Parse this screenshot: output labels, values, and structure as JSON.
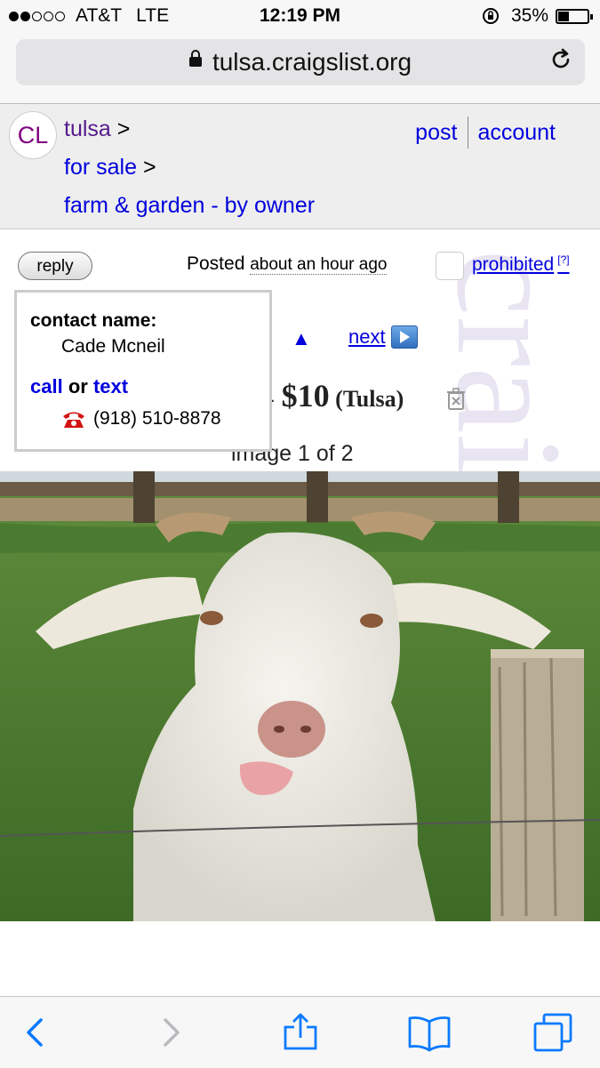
{
  "status_bar": {
    "signal_dots_filled": 2,
    "signal_dots_total": 5,
    "carrier": "AT&T",
    "network": "LTE",
    "time": "12:19 PM",
    "battery": "35%",
    "battery_level": 0.35
  },
  "browser": {
    "url": "tulsa.craigslist.org"
  },
  "header": {
    "logo": "CL",
    "crumbs": [
      {
        "label": "tulsa",
        "sep": ">"
      },
      {
        "label": "for sale",
        "sep": ">"
      },
      {
        "label": "farm & garden - by owner",
        "sep": ""
      }
    ],
    "post_label": "post",
    "account_label": "account"
  },
  "posting": {
    "reply_label": "reply",
    "posted_label": "Posted",
    "posted_ago": "about an hour ago",
    "prohibited_label": "prohibited",
    "prohibited_help": "[?]",
    "next_label": "next",
    "title_dash": "-",
    "price": "$10",
    "location": "(Tulsa)",
    "image_counter": "image 1 of 2"
  },
  "contact": {
    "name_label": "contact name:",
    "name": "Cade Mcneil",
    "call_label": "call",
    "or_label": "or",
    "text_label": "text",
    "phone": "(918) 510-8878"
  },
  "watermark_text": "craigslist",
  "colors": {
    "link": "#0000dd",
    "visited": "#551a8b",
    "header_bg": "#eeeeee",
    "ios_blue": "#0a7aff"
  }
}
